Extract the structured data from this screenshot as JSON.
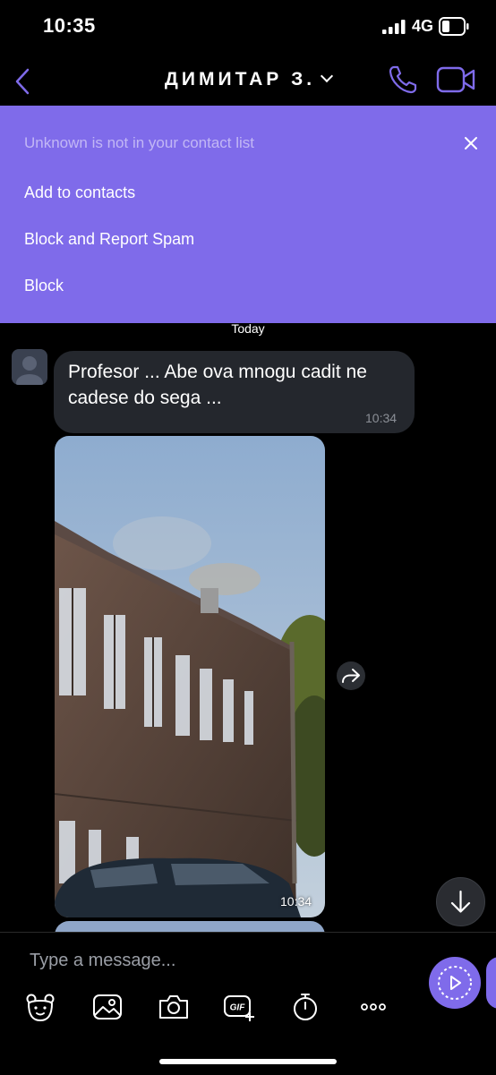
{
  "status_bar": {
    "time": "10:35",
    "network": "4G"
  },
  "header": {
    "contact_name": "ДИМИТАР З."
  },
  "banner": {
    "note": "Unknown is not in your contact list",
    "actions": [
      "Add to contacts",
      "Block and Report Spam",
      "Block"
    ]
  },
  "conversation": {
    "date_divider": "Today",
    "messages": [
      {
        "type": "text",
        "text": "Profesor ... Abe ova mnogu cadit ne cadese do sega ...",
        "time": "10:34"
      },
      {
        "type": "photo",
        "time": "10:34"
      }
    ]
  },
  "composer": {
    "placeholder": "Type a message..."
  },
  "toolbar_icons": [
    "sticker-icon",
    "gallery-icon",
    "camera-icon",
    "gif-icon",
    "timer-icon",
    "more-icon"
  ],
  "colors": {
    "accent": "#7f6bea",
    "bubble": "#24272d",
    "background": "#000000"
  }
}
